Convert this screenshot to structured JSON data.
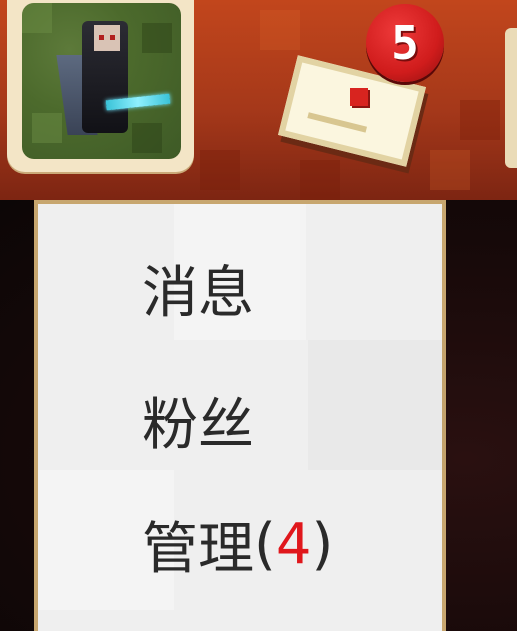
{
  "header": {
    "notification_badge": "5"
  },
  "menu": {
    "items": [
      {
        "label": "消息"
      },
      {
        "label": "粉丝"
      },
      {
        "label": "管理",
        "count_open": "(",
        "count": "4",
        "count_close": ")"
      }
    ]
  },
  "colors": {
    "header_red": "#a5381a",
    "menu_bg": "#efefef",
    "menu_border": "#c7a66f",
    "badge_red": "#d01c1c",
    "count_red": "#e0171c",
    "text": "#2a2a2a"
  },
  "icons": [
    "avatar",
    "mail-icon",
    "notification-badge"
  ]
}
